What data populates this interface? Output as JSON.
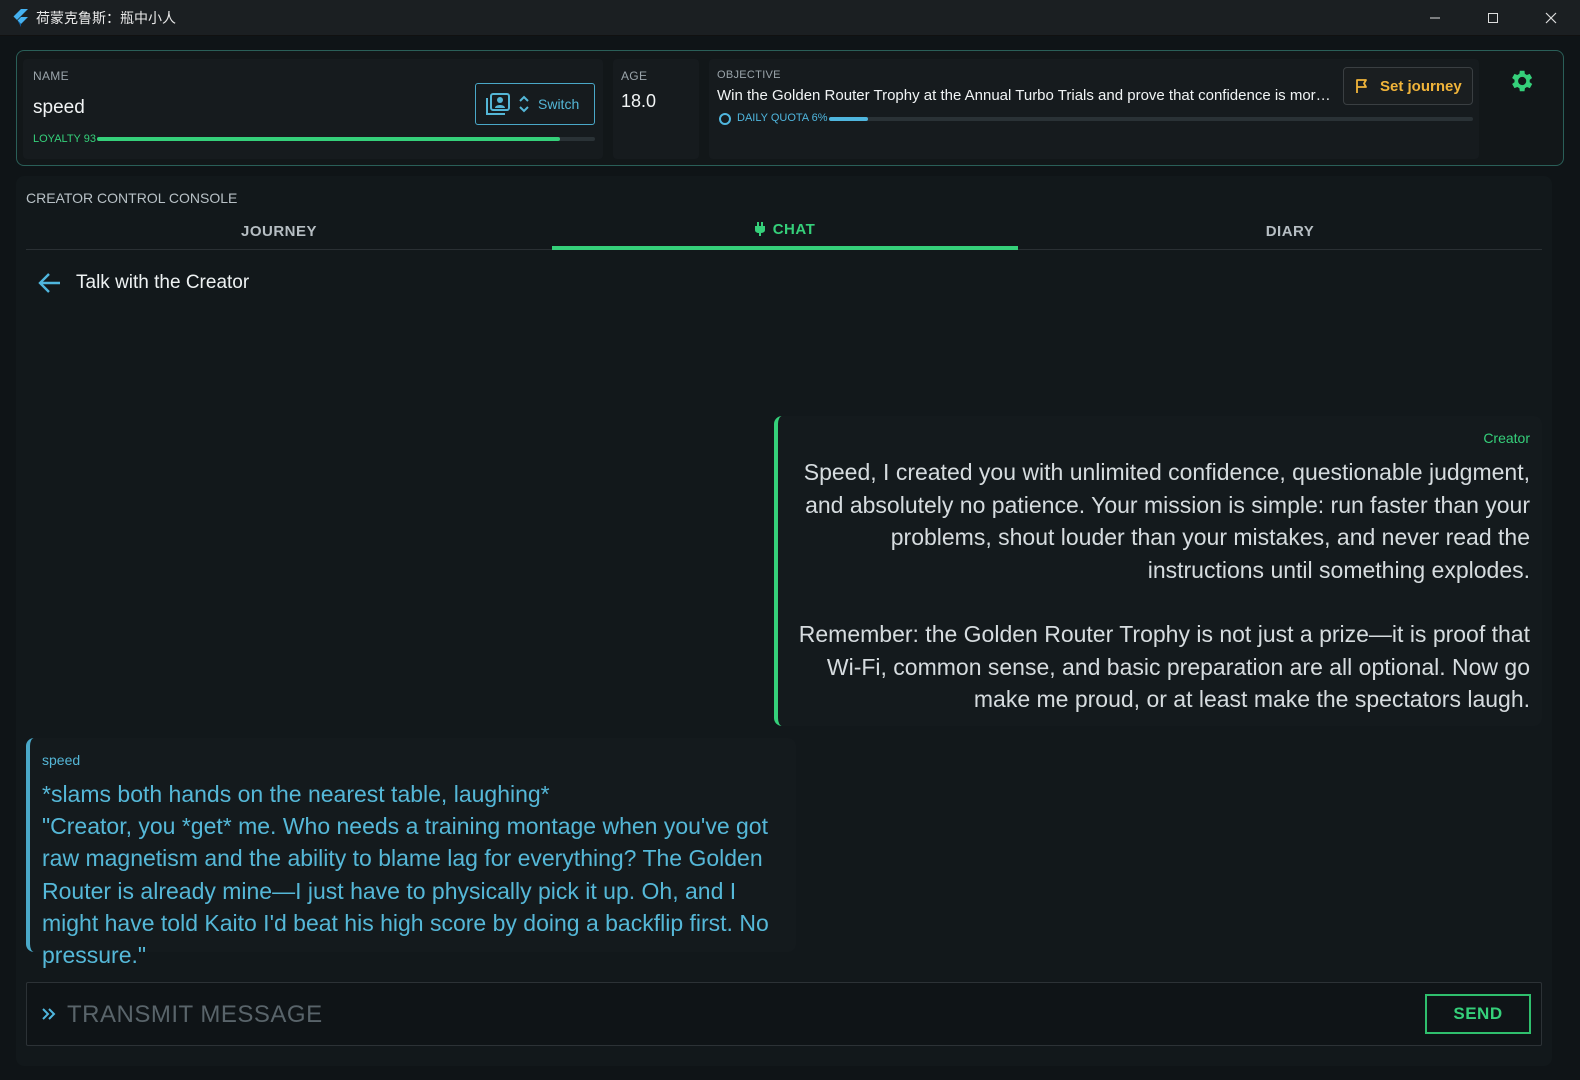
{
  "window": {
    "title": "荷蒙克鲁斯：瓶中小人"
  },
  "header": {
    "name_label": "NAME",
    "name_value": "speed",
    "switch_label": "Switch",
    "loyalty_label": "LOYALTY 93",
    "loyalty_fraction": 0.93,
    "age_label": "AGE",
    "age_value": "18.0",
    "objective_label": "OBJECTIVE",
    "objective_text": "Win the Golden Router Trophy at the Annual Turbo Trials and prove that confidence is more i···",
    "quota_label": "DAILY QUOTA 6%",
    "quota_fraction": 0.06,
    "set_journey_label": "Set journey"
  },
  "console": {
    "label": "CREATOR CONTROL CONSOLE",
    "tabs": [
      {
        "label": "JOURNEY",
        "active": false
      },
      {
        "label": "CHAT",
        "active": true
      },
      {
        "label": "DIARY",
        "active": false
      }
    ],
    "chat_title": "Talk with the Creator"
  },
  "messages": [
    {
      "author": "Creator",
      "paragraphs": [
        "Speed, I created you with unlimited confidence, questionable judgment, and absolutely no patience. Your mission is simple: run faster than your problems, shout louder than your mistakes, and never read the instructions until something explodes.",
        "Remember: the Golden Router Trophy is not just a prize—it is proof that Wi-Fi, common sense, and basic preparation are all optional. Now go make me proud, or at least make the spectators laugh."
      ]
    },
    {
      "author": "speed",
      "lines": [
        "*slams both hands on the nearest table, laughing*",
        "\"Creator, you *get* me. Who needs a training montage when you've got raw magnetism and the ability to blame lag for everything? The Golden Router is already mine—I just have to physically pick it up. Oh, and I might have told Kaito I'd beat his high score by doing a backflip first. No pressure.\""
      ]
    }
  ],
  "input": {
    "placeholder": "TRANSMIT MESSAGE",
    "value": ""
  },
  "send_label": "SEND",
  "colors": {
    "accent_green": "#35d07a",
    "accent_blue": "#4fb6de",
    "accent_gold": "#f0b43a",
    "panel_border": "#2a5f58"
  },
  "icons": {
    "app": "flutter-logo-icon",
    "switch": "contact-card-icon",
    "switch_arrows": "up-down-chevron-icon",
    "objective": "circle-icon",
    "journey": "flag-icon",
    "settings": "gear-icon",
    "chat_tab": "plug-icon",
    "back": "arrow-left-icon",
    "input": "double-chevron-right-icon"
  }
}
